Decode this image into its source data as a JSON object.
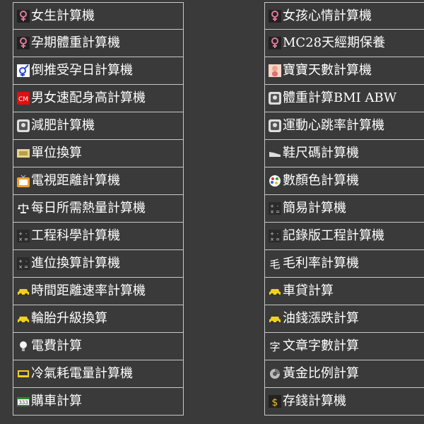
{
  "left_items": [
    {
      "label": "女生計算機",
      "icon": "female-icon"
    },
    {
      "label": "孕期體重計算機",
      "icon": "female-icon"
    },
    {
      "label": "倒推受孕日計算機",
      "icon": "gender-icon"
    },
    {
      "label": "男女速配身高計算機",
      "icon": "cm-icon"
    },
    {
      "label": "減肥計算機",
      "icon": "scale-icon"
    },
    {
      "label": "單位換算",
      "icon": "unit-icon"
    },
    {
      "label": "電視距離計算機",
      "icon": "tv-icon"
    },
    {
      "label": "每日所需熱量計算機",
      "icon": "balance-icon"
    },
    {
      "label": "工程科學計算機",
      "icon": "calculator-icon"
    },
    {
      "label": "進位換算計算機",
      "icon": "calculator-icon"
    },
    {
      "label": "時間距離速率計算機",
      "icon": "car-icon"
    },
    {
      "label": "輪胎升級換算",
      "icon": "car-icon"
    },
    {
      "label": "電費計算",
      "icon": "bulb-icon"
    },
    {
      "label": "冷氣耗電量計算機",
      "icon": "aircon-icon"
    },
    {
      "label": "購車計算",
      "icon": "plate-icon"
    }
  ],
  "right_items": [
    {
      "label": "女孩心情計算機",
      "icon": "female-icon"
    },
    {
      "label": "MC28天經期保養",
      "icon": "female-icon"
    },
    {
      "label": "寶寶天數計算機",
      "icon": "baby-icon"
    },
    {
      "label": "體重計算BMI ABW",
      "icon": "scale-icon"
    },
    {
      "label": "運動心跳率計算機",
      "icon": "scale-icon"
    },
    {
      "label": "鞋尺碼計算機",
      "icon": "shoe-icon"
    },
    {
      "label": "數顏色計算機",
      "icon": "palette-icon"
    },
    {
      "label": "簡易計算機",
      "icon": "calculator-icon"
    },
    {
      "label": "記錄版工程計算機",
      "icon": "calculator-icon"
    },
    {
      "label": "毛利率計算機",
      "icon": "hair-icon"
    },
    {
      "label": "車貸計算",
      "icon": "car-icon"
    },
    {
      "label": "油錢漲跌計算",
      "icon": "car-icon"
    },
    {
      "label": "文章字數計算",
      "icon": "text-icon"
    },
    {
      "label": "黃金比例計算",
      "icon": "gold-icon"
    },
    {
      "label": "存錢計算機",
      "icon": "money-icon"
    }
  ]
}
